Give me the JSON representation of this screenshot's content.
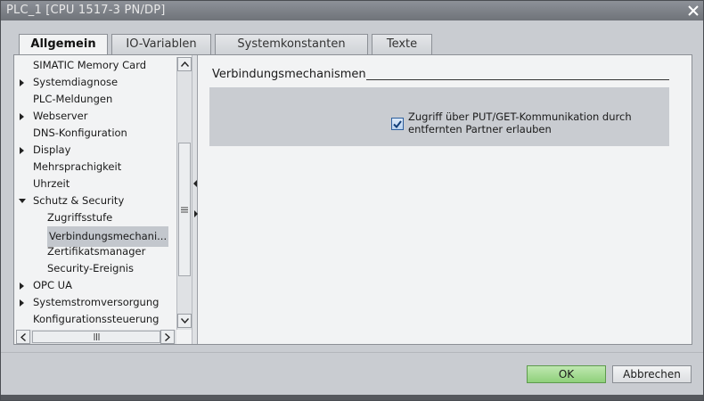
{
  "window": {
    "title": "PLC_1 [CPU 1517-3 PN/DP]"
  },
  "tabs": [
    {
      "label": "Allgemein",
      "active": true
    },
    {
      "label": "IO-Variablen",
      "active": false
    },
    {
      "label": "Systemkonstanten",
      "active": false
    },
    {
      "label": "Texte",
      "active": false
    }
  ],
  "nav": {
    "items": [
      {
        "label": "SIMATIC Memory Card",
        "level": 0,
        "expander": "none"
      },
      {
        "label": "Systemdiagnose",
        "level": 0,
        "expander": "collapsed"
      },
      {
        "label": "PLC-Meldungen",
        "level": 0,
        "expander": "none"
      },
      {
        "label": "Webserver",
        "level": 0,
        "expander": "collapsed"
      },
      {
        "label": "DNS-Konfiguration",
        "level": 0,
        "expander": "none"
      },
      {
        "label": "Display",
        "level": 0,
        "expander": "collapsed"
      },
      {
        "label": "Mehrsprachigkeit",
        "level": 0,
        "expander": "none"
      },
      {
        "label": "Uhrzeit",
        "level": 0,
        "expander": "none"
      },
      {
        "label": "Schutz & Security",
        "level": 0,
        "expander": "expanded"
      },
      {
        "label": "Zugriffsstufe",
        "level": 1,
        "expander": "none"
      },
      {
        "label": "Verbindungsmechani...",
        "level": 1,
        "expander": "none",
        "selected": true
      },
      {
        "label": "Zertifikatsmanager",
        "level": 1,
        "expander": "none"
      },
      {
        "label": "Security-Ereignis",
        "level": 1,
        "expander": "none"
      },
      {
        "label": "OPC UA",
        "level": 0,
        "expander": "collapsed"
      },
      {
        "label": "Systemstromversorgung",
        "level": 0,
        "expander": "collapsed"
      },
      {
        "label": "Konfigurationssteuerung",
        "level": 0,
        "expander": "none"
      }
    ]
  },
  "section": {
    "title": "Verbindungsmechanismen",
    "checkbox_label": "Zugriff über PUT/GET-Kommunikation durch entfernten Partner erlauben",
    "checkbox_checked": true
  },
  "buttons": {
    "ok": "OK",
    "cancel": "Abbrechen"
  },
  "colors": {
    "ok_button": "#8fd07a",
    "checkbox_border": "#2d5f9e"
  }
}
